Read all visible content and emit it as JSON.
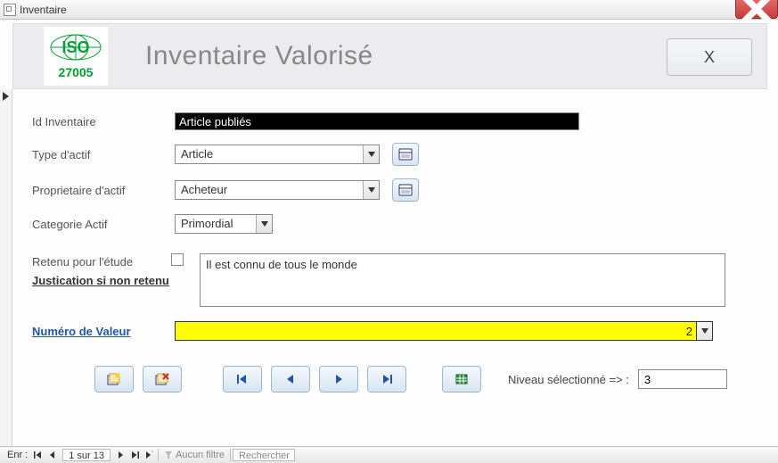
{
  "window": {
    "title": "Inventaire"
  },
  "header": {
    "logo_top": "ISO",
    "logo_code": "27005",
    "title": "Inventaire Valorisé",
    "close_label": "X"
  },
  "form": {
    "id_label": "Id Inventaire",
    "id_value": "Article publiés",
    "type_label": "Type d'actif",
    "type_value": "Article",
    "prop_label": "Proprietaire d'actif",
    "prop_value": "Acheteur",
    "cat_label": "Categorie Actif",
    "cat_value": "Primordial",
    "retenu_label": "Retenu pour l'étude",
    "justif_label": "Justication si non retenu",
    "justif_value": "Il est connu de tous le monde",
    "numval_label": "Numéro de Valeur",
    "numval_value": "2",
    "niveau_label": "Niveau sélectionné => :",
    "niveau_value": "3"
  },
  "recbar": {
    "prefix": "Enr :",
    "position": "1 sur 13",
    "filter": "Aucun filtre",
    "search": "Rechercher"
  }
}
